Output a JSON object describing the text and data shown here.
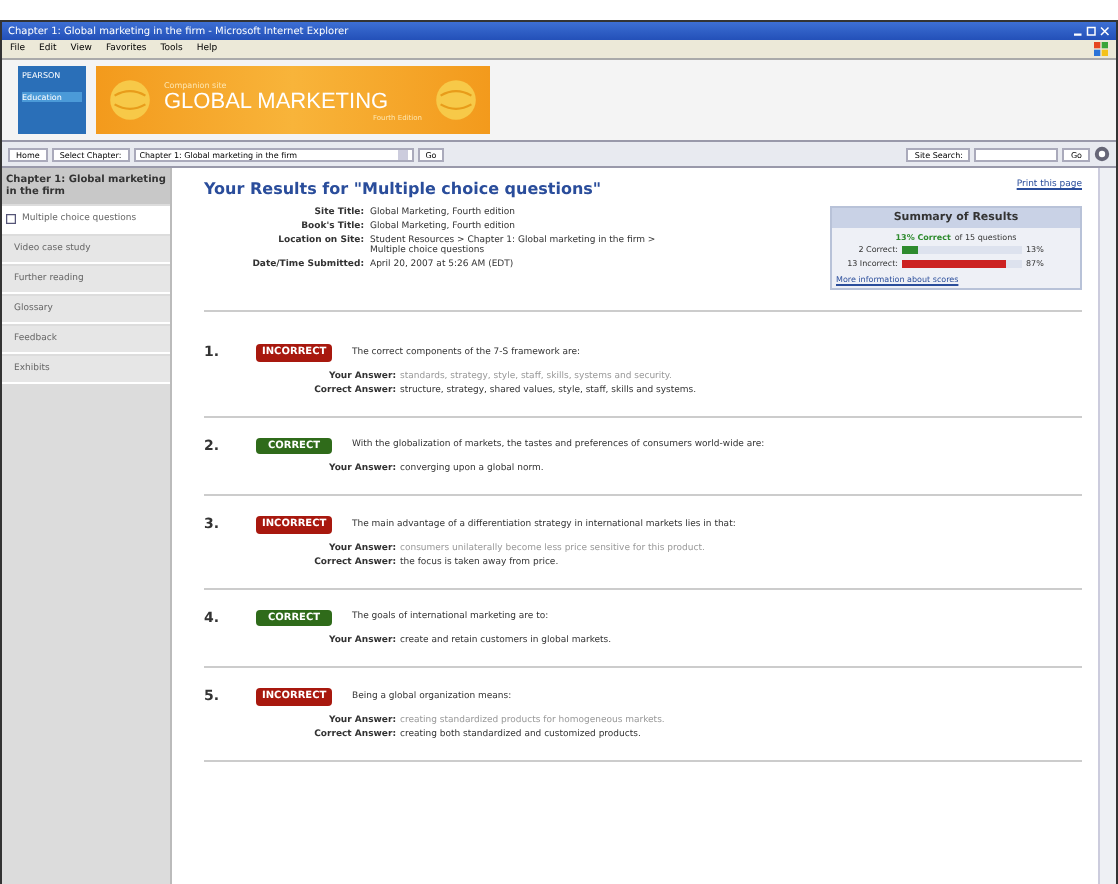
{
  "window": {
    "title": "Chapter 1: Global marketing in the firm - Microsoft Internet Explorer"
  },
  "menu": [
    "File",
    "Edit",
    "View",
    "Favorites",
    "Tools",
    "Help"
  ],
  "banner": {
    "publisher_line1": "PEARSON",
    "publisher_line2": "Education",
    "kicker": "Companion site",
    "title": "GLOBAL MARKETING",
    "subtitle": "Fourth Edition"
  },
  "toolbar": {
    "home": "Home",
    "select_chapter": "Select Chapter:",
    "chapter_value": "Chapter 1: Global marketing in the firm",
    "go": "Go",
    "site_search": "Site Search:",
    "search_go": "Go"
  },
  "sidebar": {
    "heading": "Chapter 1: Global marketing in the firm",
    "items": [
      {
        "label": "Multiple choice questions",
        "selected": true
      },
      {
        "label": "Video case study",
        "selected": false
      },
      {
        "label": "Further reading",
        "selected": false
      },
      {
        "label": "Glossary",
        "selected": false
      },
      {
        "label": "Feedback",
        "selected": false
      },
      {
        "label": "Exhibits",
        "selected": false
      }
    ]
  },
  "results": {
    "heading": "Your Results for \"Multiple choice questions\"",
    "print_link": "Print this page",
    "meta": [
      {
        "label": "Site Title:",
        "value": "Global Marketing, Fourth edition"
      },
      {
        "label": "Book's Title:",
        "value": "Global Marketing, Fourth edition"
      },
      {
        "label": "Location on Site:",
        "value": "Student Resources > Chapter 1: Global marketing in the firm > Multiple choice questions"
      },
      {
        "label": "Date/Time Submitted:",
        "value": "April 20, 2007 at 5:26 AM (EDT)"
      }
    ],
    "summary": {
      "title": "Summary of Results",
      "score": "13% Correct",
      "score_rest": "of 15 questions",
      "rows": [
        {
          "label": "2 Correct:",
          "level": 0.13,
          "reading": "13%",
          "color": "#2e8b2e"
        },
        {
          "label": "13 Incorrect:",
          "level": 0.87,
          "reading": "87%",
          "color": "#cc2222"
        }
      ],
      "link": "More information about scores"
    }
  },
  "questions": [
    {
      "number": "1.",
      "correct": false,
      "badge": "INCORRECT",
      "text": "The correct components of the 7-S framework are:",
      "answers": [
        {
          "label": "Your Answer:",
          "value": "standards, strategy, style, staff, skills, systems and security."
        },
        {
          "label": "Correct Answer:",
          "value": "structure, strategy, shared values, style, staff, skills and systems."
        }
      ]
    },
    {
      "number": "2.",
      "correct": true,
      "badge": "CORRECT",
      "text": "With the globalization of markets, the tastes and preferences of consumers world-wide are:",
      "answers": [
        {
          "label": "Your Answer:",
          "value": "converging upon a global norm."
        }
      ]
    },
    {
      "number": "3.",
      "correct": false,
      "badge": "INCORRECT",
      "text": "The main advantage of a differentiation strategy in international markets lies in that:",
      "answers": [
        {
          "label": "Your Answer:",
          "value": "consumers unilaterally become less price sensitive for this product."
        },
        {
          "label": "Correct Answer:",
          "value": "the focus is taken away from price."
        }
      ]
    },
    {
      "number": "4.",
      "correct": true,
      "badge": "CORRECT",
      "text": "The goals of international marketing are to:",
      "answers": [
        {
          "label": "Your Answer:",
          "value": "create and retain customers in global markets."
        }
      ]
    },
    {
      "number": "5.",
      "correct": false,
      "badge": "INCORRECT",
      "text": "Being a global organization means:",
      "answers": [
        {
          "label": "Your Answer:",
          "value": "creating standardized products for homogeneous markets."
        },
        {
          "label": "Correct Answer:",
          "value": "creating both standardized and customized products."
        }
      ]
    }
  ]
}
